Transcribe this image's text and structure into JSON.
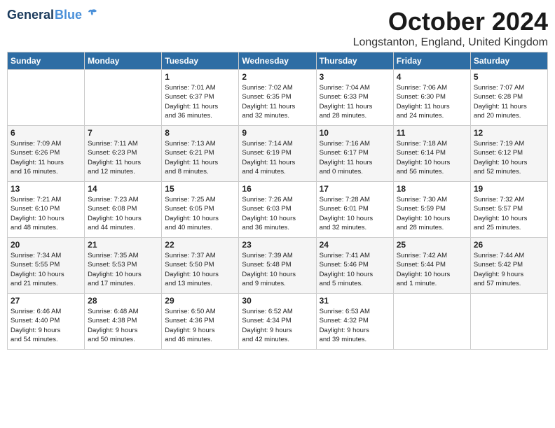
{
  "header": {
    "logo_general": "General",
    "logo_blue": "Blue",
    "month_title": "October 2024",
    "location": "Longstanton, England, United Kingdom"
  },
  "days_of_week": [
    "Sunday",
    "Monday",
    "Tuesday",
    "Wednesday",
    "Thursday",
    "Friday",
    "Saturday"
  ],
  "weeks": [
    [
      {
        "day": "",
        "content": ""
      },
      {
        "day": "",
        "content": ""
      },
      {
        "day": "1",
        "content": "Sunrise: 7:01 AM\nSunset: 6:37 PM\nDaylight: 11 hours\nand 36 minutes."
      },
      {
        "day": "2",
        "content": "Sunrise: 7:02 AM\nSunset: 6:35 PM\nDaylight: 11 hours\nand 32 minutes."
      },
      {
        "day": "3",
        "content": "Sunrise: 7:04 AM\nSunset: 6:33 PM\nDaylight: 11 hours\nand 28 minutes."
      },
      {
        "day": "4",
        "content": "Sunrise: 7:06 AM\nSunset: 6:30 PM\nDaylight: 11 hours\nand 24 minutes."
      },
      {
        "day": "5",
        "content": "Sunrise: 7:07 AM\nSunset: 6:28 PM\nDaylight: 11 hours\nand 20 minutes."
      }
    ],
    [
      {
        "day": "6",
        "content": "Sunrise: 7:09 AM\nSunset: 6:26 PM\nDaylight: 11 hours\nand 16 minutes."
      },
      {
        "day": "7",
        "content": "Sunrise: 7:11 AM\nSunset: 6:23 PM\nDaylight: 11 hours\nand 12 minutes."
      },
      {
        "day": "8",
        "content": "Sunrise: 7:13 AM\nSunset: 6:21 PM\nDaylight: 11 hours\nand 8 minutes."
      },
      {
        "day": "9",
        "content": "Sunrise: 7:14 AM\nSunset: 6:19 PM\nDaylight: 11 hours\nand 4 minutes."
      },
      {
        "day": "10",
        "content": "Sunrise: 7:16 AM\nSunset: 6:17 PM\nDaylight: 11 hours\nand 0 minutes."
      },
      {
        "day": "11",
        "content": "Sunrise: 7:18 AM\nSunset: 6:14 PM\nDaylight: 10 hours\nand 56 minutes."
      },
      {
        "day": "12",
        "content": "Sunrise: 7:19 AM\nSunset: 6:12 PM\nDaylight: 10 hours\nand 52 minutes."
      }
    ],
    [
      {
        "day": "13",
        "content": "Sunrise: 7:21 AM\nSunset: 6:10 PM\nDaylight: 10 hours\nand 48 minutes."
      },
      {
        "day": "14",
        "content": "Sunrise: 7:23 AM\nSunset: 6:08 PM\nDaylight: 10 hours\nand 44 minutes."
      },
      {
        "day": "15",
        "content": "Sunrise: 7:25 AM\nSunset: 6:05 PM\nDaylight: 10 hours\nand 40 minutes."
      },
      {
        "day": "16",
        "content": "Sunrise: 7:26 AM\nSunset: 6:03 PM\nDaylight: 10 hours\nand 36 minutes."
      },
      {
        "day": "17",
        "content": "Sunrise: 7:28 AM\nSunset: 6:01 PM\nDaylight: 10 hours\nand 32 minutes."
      },
      {
        "day": "18",
        "content": "Sunrise: 7:30 AM\nSunset: 5:59 PM\nDaylight: 10 hours\nand 28 minutes."
      },
      {
        "day": "19",
        "content": "Sunrise: 7:32 AM\nSunset: 5:57 PM\nDaylight: 10 hours\nand 25 minutes."
      }
    ],
    [
      {
        "day": "20",
        "content": "Sunrise: 7:34 AM\nSunset: 5:55 PM\nDaylight: 10 hours\nand 21 minutes."
      },
      {
        "day": "21",
        "content": "Sunrise: 7:35 AM\nSunset: 5:53 PM\nDaylight: 10 hours\nand 17 minutes."
      },
      {
        "day": "22",
        "content": "Sunrise: 7:37 AM\nSunset: 5:50 PM\nDaylight: 10 hours\nand 13 minutes."
      },
      {
        "day": "23",
        "content": "Sunrise: 7:39 AM\nSunset: 5:48 PM\nDaylight: 10 hours\nand 9 minutes."
      },
      {
        "day": "24",
        "content": "Sunrise: 7:41 AM\nSunset: 5:46 PM\nDaylight: 10 hours\nand 5 minutes."
      },
      {
        "day": "25",
        "content": "Sunrise: 7:42 AM\nSunset: 5:44 PM\nDaylight: 10 hours\nand 1 minute."
      },
      {
        "day": "26",
        "content": "Sunrise: 7:44 AM\nSunset: 5:42 PM\nDaylight: 9 hours\nand 57 minutes."
      }
    ],
    [
      {
        "day": "27",
        "content": "Sunrise: 6:46 AM\nSunset: 4:40 PM\nDaylight: 9 hours\nand 54 minutes."
      },
      {
        "day": "28",
        "content": "Sunrise: 6:48 AM\nSunset: 4:38 PM\nDaylight: 9 hours\nand 50 minutes."
      },
      {
        "day": "29",
        "content": "Sunrise: 6:50 AM\nSunset: 4:36 PM\nDaylight: 9 hours\nand 46 minutes."
      },
      {
        "day": "30",
        "content": "Sunrise: 6:52 AM\nSunset: 4:34 PM\nDaylight: 9 hours\nand 42 minutes."
      },
      {
        "day": "31",
        "content": "Sunrise: 6:53 AM\nSunset: 4:32 PM\nDaylight: 9 hours\nand 39 minutes."
      },
      {
        "day": "",
        "content": ""
      },
      {
        "day": "",
        "content": ""
      }
    ]
  ]
}
